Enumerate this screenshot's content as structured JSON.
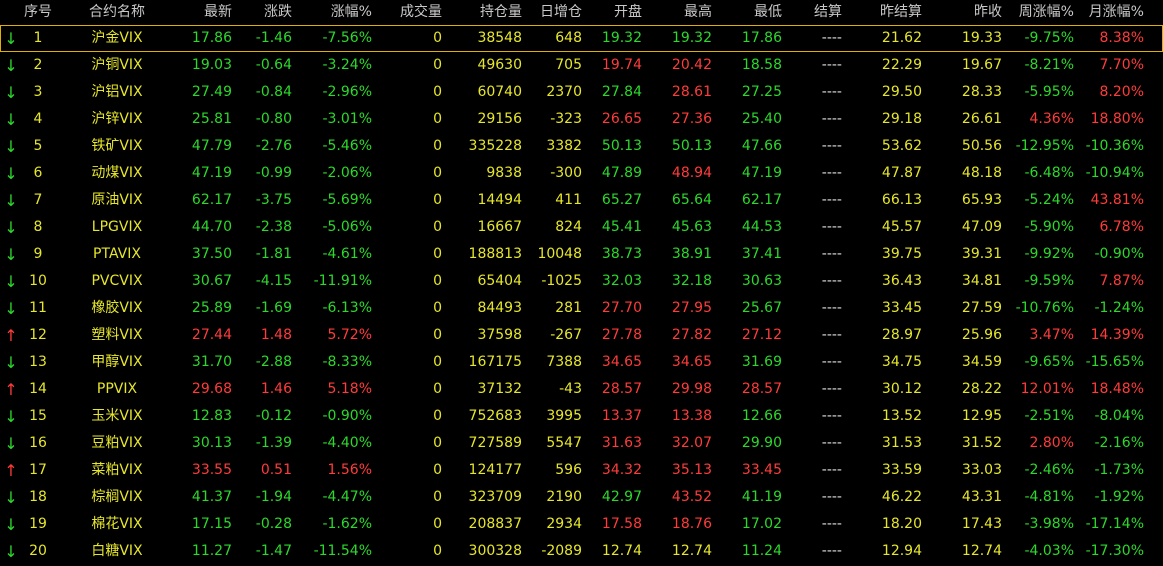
{
  "colors": {
    "up": "#ff3b3b",
    "down": "#2bd92b",
    "neutral": "#e6e62c",
    "header": "#c8c8c8",
    "background": "#000000",
    "selected_outline": "#e0b000"
  },
  "headers": [
    "序号",
    "合约名称",
    "最新",
    "涨跌",
    "涨幅%",
    "成交量",
    "持仓量",
    "日增仓",
    "开盘",
    "最高",
    "最低",
    "结算",
    "昨结算",
    "昨收",
    "周涨幅%",
    "月涨幅%"
  ],
  "rows": [
    {
      "dir": "down",
      "no": "1",
      "name": "沪金VIX",
      "last": "17.86",
      "chg": "-1.46",
      "pct": "-7.56%",
      "vol": "0",
      "oi": "38548",
      "oi_chg": "648",
      "open": "19.32",
      "high": "19.32",
      "low": "17.86",
      "settle": "----",
      "pre_settle": "21.62",
      "pre_close": "19.33",
      "week": "-9.75%",
      "month": "8.38%"
    },
    {
      "dir": "down",
      "no": "2",
      "name": "沪铜VIX",
      "last": "19.03",
      "chg": "-0.64",
      "pct": "-3.24%",
      "vol": "0",
      "oi": "49630",
      "oi_chg": "705",
      "open": "19.74",
      "high": "20.42",
      "low": "18.58",
      "settle": "----",
      "pre_settle": "22.29",
      "pre_close": "19.67",
      "week": "-8.21%",
      "month": "7.70%"
    },
    {
      "dir": "down",
      "no": "3",
      "name": "沪铝VIX",
      "last": "27.49",
      "chg": "-0.84",
      "pct": "-2.96%",
      "vol": "0",
      "oi": "60740",
      "oi_chg": "2370",
      "open": "27.84",
      "high": "28.61",
      "low": "27.25",
      "settle": "----",
      "pre_settle": "29.50",
      "pre_close": "28.33",
      "week": "-5.95%",
      "month": "8.20%"
    },
    {
      "dir": "down",
      "no": "4",
      "name": "沪锌VIX",
      "last": "25.81",
      "chg": "-0.80",
      "pct": "-3.01%",
      "vol": "0",
      "oi": "29156",
      "oi_chg": "-323",
      "open": "26.65",
      "high": "27.36",
      "low": "25.40",
      "settle": "----",
      "pre_settle": "29.18",
      "pre_close": "26.61",
      "week": "4.36%",
      "month": "18.80%"
    },
    {
      "dir": "down",
      "no": "5",
      "name": "铁矿VIX",
      "last": "47.79",
      "chg": "-2.76",
      "pct": "-5.46%",
      "vol": "0",
      "oi": "335228",
      "oi_chg": "3382",
      "open": "50.13",
      "high": "50.13",
      "low": "47.66",
      "settle": "----",
      "pre_settle": "53.62",
      "pre_close": "50.56",
      "week": "-12.95%",
      "month": "-10.36%"
    },
    {
      "dir": "down",
      "no": "6",
      "name": "动煤VIX",
      "last": "47.19",
      "chg": "-0.99",
      "pct": "-2.06%",
      "vol": "0",
      "oi": "9838",
      "oi_chg": "-300",
      "open": "47.89",
      "high": "48.94",
      "low": "47.19",
      "settle": "----",
      "pre_settle": "47.87",
      "pre_close": "48.18",
      "week": "-6.48%",
      "month": "-10.94%"
    },
    {
      "dir": "down",
      "no": "7",
      "name": "原油VIX",
      "last": "62.17",
      "chg": "-3.75",
      "pct": "-5.69%",
      "vol": "0",
      "oi": "14494",
      "oi_chg": "411",
      "open": "65.27",
      "high": "65.64",
      "low": "62.17",
      "settle": "----",
      "pre_settle": "66.13",
      "pre_close": "65.93",
      "week": "-5.24%",
      "month": "43.81%"
    },
    {
      "dir": "down",
      "no": "8",
      "name": "LPGVIX",
      "last": "44.70",
      "chg": "-2.38",
      "pct": "-5.06%",
      "vol": "0",
      "oi": "16667",
      "oi_chg": "824",
      "open": "45.41",
      "high": "45.63",
      "low": "44.53",
      "settle": "----",
      "pre_settle": "45.57",
      "pre_close": "47.09",
      "week": "-5.90%",
      "month": "6.78%"
    },
    {
      "dir": "down",
      "no": "9",
      "name": "PTAVIX",
      "last": "37.50",
      "chg": "-1.81",
      "pct": "-4.61%",
      "vol": "0",
      "oi": "188813",
      "oi_chg": "10048",
      "open": "38.73",
      "high": "38.91",
      "low": "37.41",
      "settle": "----",
      "pre_settle": "39.75",
      "pre_close": "39.31",
      "week": "-9.92%",
      "month": "-0.90%"
    },
    {
      "dir": "down",
      "no": "10",
      "name": "PVCVIX",
      "last": "30.67",
      "chg": "-4.15",
      "pct": "-11.91%",
      "vol": "0",
      "oi": "65404",
      "oi_chg": "-1025",
      "open": "32.03",
      "high": "32.18",
      "low": "30.63",
      "settle": "----",
      "pre_settle": "36.43",
      "pre_close": "34.81",
      "week": "-9.59%",
      "month": "7.87%"
    },
    {
      "dir": "down",
      "no": "11",
      "name": "橡胶VIX",
      "last": "25.89",
      "chg": "-1.69",
      "pct": "-6.13%",
      "vol": "0",
      "oi": "84493",
      "oi_chg": "281",
      "open": "27.70",
      "high": "27.95",
      "low": "25.67",
      "settle": "----",
      "pre_settle": "33.45",
      "pre_close": "27.59",
      "week": "-10.76%",
      "month": "-1.24%"
    },
    {
      "dir": "up",
      "no": "12",
      "name": "塑料VIX",
      "last": "27.44",
      "chg": "1.48",
      "pct": "5.72%",
      "vol": "0",
      "oi": "37598",
      "oi_chg": "-267",
      "open": "27.78",
      "high": "27.82",
      "low": "27.12",
      "settle": "----",
      "pre_settle": "28.97",
      "pre_close": "25.96",
      "week": "3.47%",
      "month": "14.39%"
    },
    {
      "dir": "down",
      "no": "13",
      "name": "甲醇VIX",
      "last": "31.70",
      "chg": "-2.88",
      "pct": "-8.33%",
      "vol": "0",
      "oi": "167175",
      "oi_chg": "7388",
      "open": "34.65",
      "high": "34.65",
      "low": "31.69",
      "settle": "----",
      "pre_settle": "34.75",
      "pre_close": "34.59",
      "week": "-9.65%",
      "month": "-15.65%"
    },
    {
      "dir": "up",
      "no": "14",
      "name": "PPVIX",
      "last": "29.68",
      "chg": "1.46",
      "pct": "5.18%",
      "vol": "0",
      "oi": "37132",
      "oi_chg": "-43",
      "open": "28.57",
      "high": "29.98",
      "low": "28.57",
      "settle": "----",
      "pre_settle": "30.12",
      "pre_close": "28.22",
      "week": "12.01%",
      "month": "18.48%"
    },
    {
      "dir": "down",
      "no": "15",
      "name": "玉米VIX",
      "last": "12.83",
      "chg": "-0.12",
      "pct": "-0.90%",
      "vol": "0",
      "oi": "752683",
      "oi_chg": "3995",
      "open": "13.37",
      "high": "13.38",
      "low": "12.66",
      "settle": "----",
      "pre_settle": "13.52",
      "pre_close": "12.95",
      "week": "-2.51%",
      "month": "-8.04%"
    },
    {
      "dir": "down",
      "no": "16",
      "name": "豆粕VIX",
      "last": "30.13",
      "chg": "-1.39",
      "pct": "-4.40%",
      "vol": "0",
      "oi": "727589",
      "oi_chg": "5547",
      "open": "31.63",
      "high": "32.07",
      "low": "29.90",
      "settle": "----",
      "pre_settle": "31.53",
      "pre_close": "31.52",
      "week": "2.80%",
      "month": "-2.16%"
    },
    {
      "dir": "up",
      "no": "17",
      "name": "菜粕VIX",
      "last": "33.55",
      "chg": "0.51",
      "pct": "1.56%",
      "vol": "0",
      "oi": "124177",
      "oi_chg": "596",
      "open": "34.32",
      "high": "35.13",
      "low": "33.45",
      "settle": "----",
      "pre_settle": "33.59",
      "pre_close": "33.03",
      "week": "-2.46%",
      "month": "-1.73%"
    },
    {
      "dir": "down",
      "no": "18",
      "name": "棕榈VIX",
      "last": "41.37",
      "chg": "-1.94",
      "pct": "-4.47%",
      "vol": "0",
      "oi": "323709",
      "oi_chg": "2190",
      "open": "42.97",
      "high": "43.52",
      "low": "41.19",
      "settle": "----",
      "pre_settle": "46.22",
      "pre_close": "43.31",
      "week": "-4.81%",
      "month": "-1.92%"
    },
    {
      "dir": "down",
      "no": "19",
      "name": "棉花VIX",
      "last": "17.15",
      "chg": "-0.28",
      "pct": "-1.62%",
      "vol": "0",
      "oi": "208837",
      "oi_chg": "2934",
      "open": "17.58",
      "high": "18.76",
      "low": "17.02",
      "settle": "----",
      "pre_settle": "18.20",
      "pre_close": "17.43",
      "week": "-3.98%",
      "month": "-17.14%"
    },
    {
      "dir": "down",
      "no": "20",
      "name": "白糖VIX",
      "last": "11.27",
      "chg": "-1.47",
      "pct": "-11.54%",
      "vol": "0",
      "oi": "300328",
      "oi_chg": "-2089",
      "open": "12.74",
      "high": "12.74",
      "low": "11.24",
      "settle": "----",
      "pre_settle": "12.94",
      "pre_close": "12.74",
      "week": "-4.03%",
      "month": "-17.30%"
    }
  ]
}
